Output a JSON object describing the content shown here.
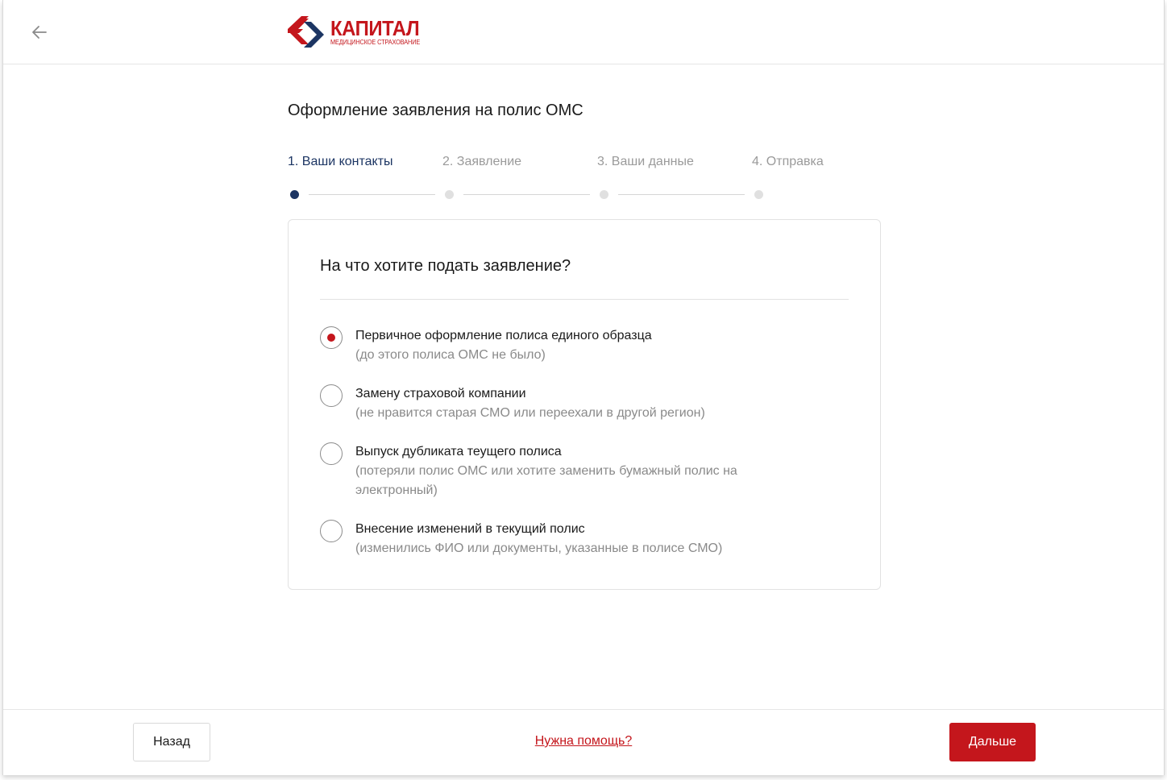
{
  "header": {
    "back_icon": "arrow-left-icon",
    "logo": {
      "name": "КАПИТАЛ",
      "subtitle": "МЕДИЦИНСКОЕ СТРАХОВАНИЕ"
    }
  },
  "page": {
    "title": "Оформление заявления на полис ОМС"
  },
  "stepper": {
    "active_index": 0,
    "steps": [
      {
        "label": "1. Ваши контакты"
      },
      {
        "label": "2. Заявление"
      },
      {
        "label": "3. Ваши данные"
      },
      {
        "label": "4. Отправка"
      }
    ]
  },
  "card": {
    "title": "На что хотите подать заявление?",
    "selected_index": 0,
    "options": [
      {
        "label": "Первичное оформление полиса единого образца",
        "hint": "(до этого полиса ОМС не было)"
      },
      {
        "label": "Замену страховой компании",
        "hint": "(не нравится старая СМО или переехали в другой регион)"
      },
      {
        "label": "Выпуск дубликата теущего полиса",
        "hint": "(потеряли полис ОМС или хотите заменить бумажный полис на электронный)"
      },
      {
        "label": "Внесение изменений в текущий полис",
        "hint": "(изменились ФИО или документы, указанные в полисе СМО)"
      }
    ]
  },
  "footer": {
    "back_label": "Назад",
    "help_label": "Нужна помощь?",
    "next_label": "Дальше"
  },
  "colors": {
    "brand_red": "#c4161c",
    "brand_blue": "#1c3563",
    "muted_text": "#8a8a8a"
  }
}
